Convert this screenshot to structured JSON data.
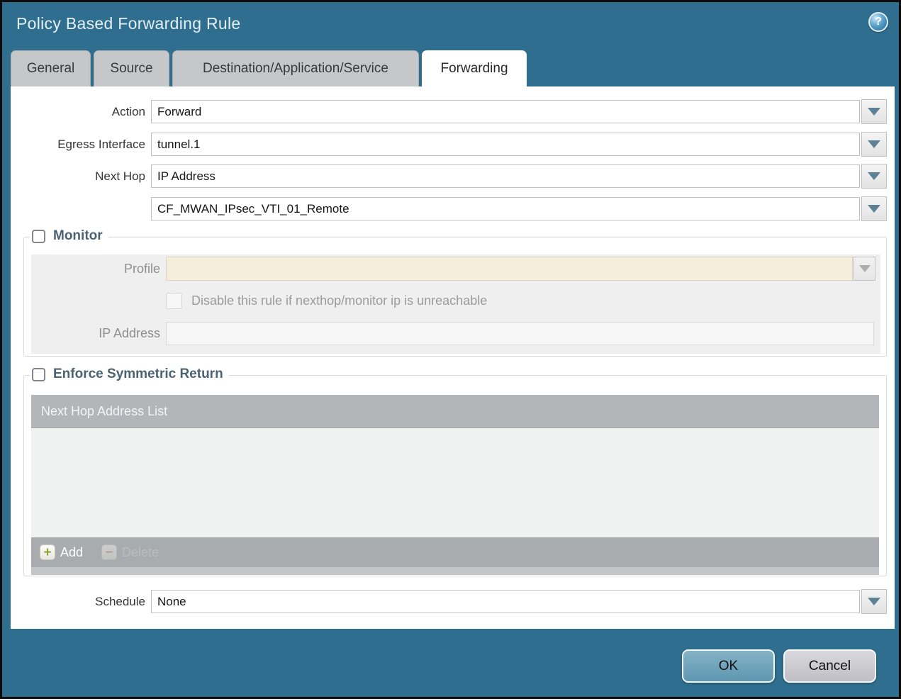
{
  "window": {
    "title": "Policy Based Forwarding Rule"
  },
  "tabs": [
    {
      "label": "General",
      "active": false
    },
    {
      "label": "Source",
      "active": false
    },
    {
      "label": "Destination/Application/Service",
      "active": false
    },
    {
      "label": "Forwarding",
      "active": true
    }
  ],
  "form": {
    "action": {
      "label": "Action",
      "value": "Forward"
    },
    "egress_interface": {
      "label": "Egress Interface",
      "value": "tunnel.1"
    },
    "next_hop": {
      "label": "Next Hop",
      "value": "IP Address"
    },
    "next_hop_address": {
      "value": "CF_MWAN_IPsec_VTI_01_Remote"
    },
    "schedule": {
      "label": "Schedule",
      "value": "None"
    }
  },
  "monitor": {
    "label": "Monitor",
    "checked": false,
    "profile": {
      "label": "Profile",
      "value": ""
    },
    "disable_rule_label": "Disable this rule if nexthop/monitor ip is unreachable",
    "disable_rule_checked": false,
    "ip_address": {
      "label": "IP Address",
      "value": ""
    }
  },
  "enforce": {
    "label": "Enforce Symmetric Return",
    "checked": false,
    "list_header": "Next Hop Address List",
    "rows": [],
    "add_label": "Add",
    "delete_label": "Delete"
  },
  "footer": {
    "ok": "OK",
    "cancel": "Cancel"
  },
  "icons": {
    "help": "?",
    "add": "+",
    "delete": "−"
  },
  "colors": {
    "titlebar_teal": "#2f6e8e",
    "tab_inactive_gray": "#c6c7c9",
    "ok_button_blue": "#69a1bb",
    "cancel_button_gray": "#c9c9cd",
    "disabled_profile_beige": "#f5eedd",
    "list_header_gray": "#b3b6b8",
    "list_footer_gray": "#a9acae",
    "add_plus_green": "#8da432",
    "delete_minus_red": "#c2868c"
  }
}
